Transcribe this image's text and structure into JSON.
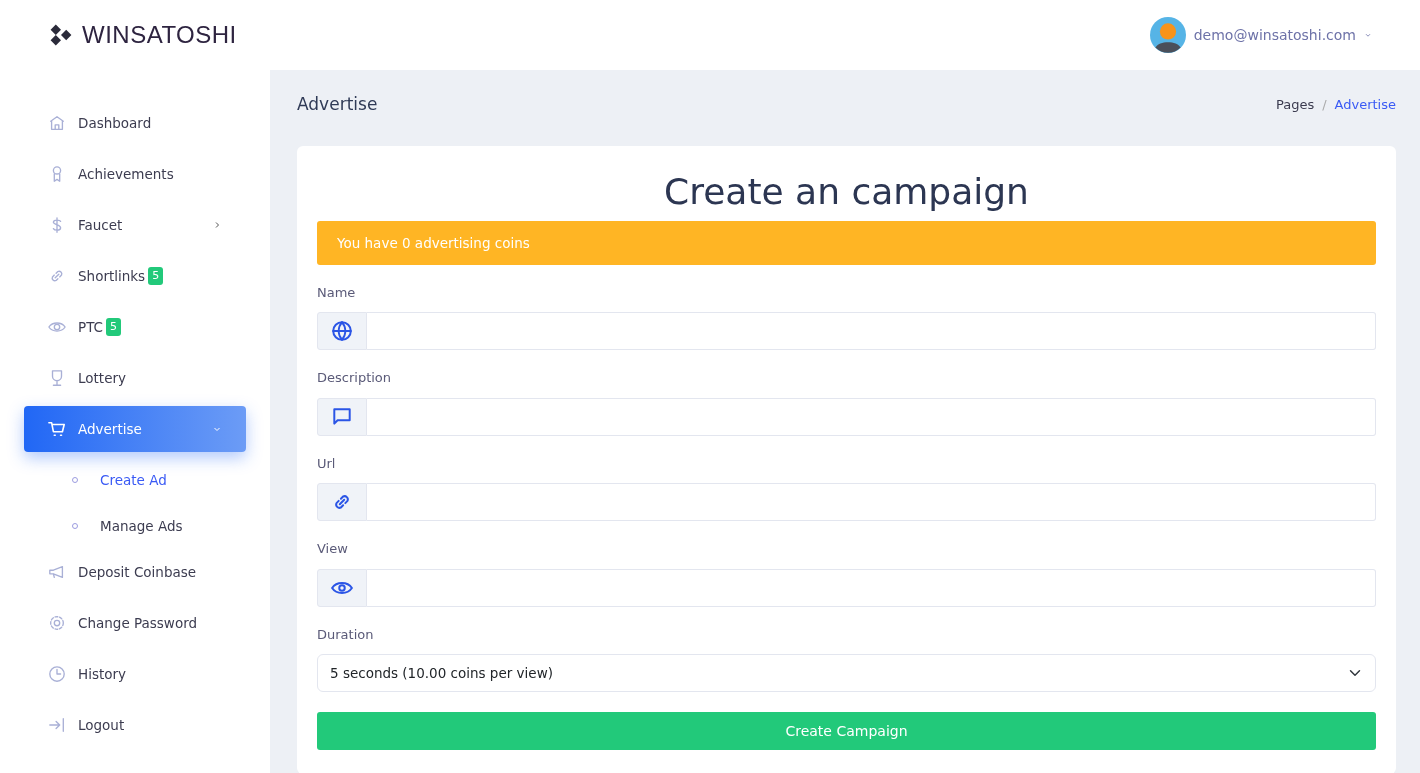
{
  "brand": {
    "name": "WINSATOSHI"
  },
  "user": {
    "email": "demo@winsatoshi.com"
  },
  "sidebar": {
    "items": [
      {
        "label": "Dashboard",
        "selected": false
      },
      {
        "label": "Achievements",
        "selected": false
      },
      {
        "label": "Faucet",
        "selected": false,
        "expanded": false
      },
      {
        "label": "Shortlinks",
        "selected": false,
        "badge": "5"
      },
      {
        "label": "PTC",
        "selected": false,
        "badge": "5"
      },
      {
        "label": "Lottery",
        "selected": false
      },
      {
        "label": "Advertise",
        "selected": true,
        "expanded": true,
        "children": [
          {
            "label": "Create Ad",
            "selected": true
          },
          {
            "label": "Manage Ads",
            "selected": false
          }
        ]
      },
      {
        "label": "Deposit Coinbase",
        "selected": false
      },
      {
        "label": "Change Password",
        "selected": false
      },
      {
        "label": "History",
        "selected": false
      },
      {
        "label": "Logout",
        "selected": false
      }
    ]
  },
  "page": {
    "title": "Advertise",
    "breadcrumb_separator": "/",
    "breadcrumb": [
      {
        "label": "Pages",
        "selected": false
      },
      {
        "label": "Advertise",
        "selected": true
      }
    ]
  },
  "form": {
    "title": "Create an campaign",
    "alert": "You have 0 advertising coins",
    "fields": [
      {
        "label": "Name"
      },
      {
        "label": "Description"
      },
      {
        "label": "Url"
      },
      {
        "label": "View"
      }
    ],
    "duration": {
      "label": "Duration",
      "value": "5 seconds (10.00 coins per view)"
    },
    "submit": "Create Campaign"
  }
}
